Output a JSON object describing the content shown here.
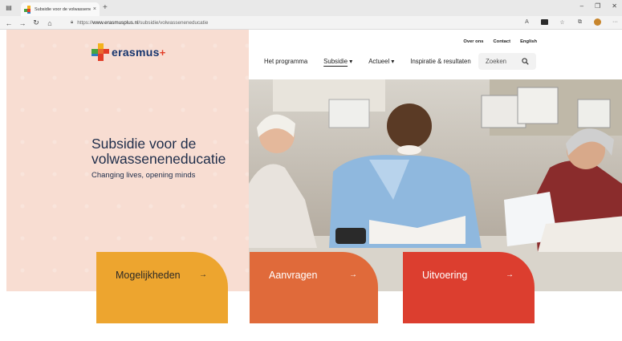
{
  "browser": {
    "tab_title": "Subsidie voor de volwasseneneducatie | Erasmus+",
    "tab_close": "×",
    "new_tab": "+",
    "url_prefix": "https://",
    "url_host": "www.erasmusplus.nl",
    "url_path": "/subsidie/volwasseneneducatie",
    "icons": [
      "tab-actions-icon",
      "back-icon",
      "forward-icon",
      "refresh-icon",
      "home-icon",
      "lock-icon",
      "read-aloud-icon",
      "extension-icon",
      "favorites-icon",
      "collections-icon",
      "profile-icon",
      "more-icon"
    ],
    "window_controls": {
      "minimize": "–",
      "maximize": "❐",
      "close": "✕"
    }
  },
  "brand": {
    "name": "erasmus",
    "plus": "+",
    "colors": {
      "navy": "#16356e",
      "red": "#e23d28",
      "yellow": "#f4b31c",
      "green": "#48a43f",
      "blue": "#2c7ec1",
      "orange": "#e86b30"
    }
  },
  "header": {
    "top_links": [
      "Over ons",
      "Contact",
      "English"
    ],
    "nav": [
      {
        "label": "Het programma",
        "dropdown": false,
        "active": false
      },
      {
        "label": "Subsidie",
        "dropdown": true,
        "active": true
      },
      {
        "label": "Actueel",
        "dropdown": true,
        "active": false
      },
      {
        "label": "Inspiratie & resultaten",
        "dropdown": false,
        "active": false
      }
    ],
    "search_placeholder": "Zoeken",
    "dropdown_glyph": "▾"
  },
  "hero": {
    "title": "Subsidie voor de volwasseneneducatie",
    "subtitle": "Changing lives, opening minds",
    "background_color": "#f8ddd2"
  },
  "cards": [
    {
      "label": "Mogelijkheden",
      "arrow": "→",
      "color": "#eda52f"
    },
    {
      "label": "Aanvragen",
      "arrow": "→",
      "color": "#e06a3a"
    },
    {
      "label": "Uitvoering",
      "arrow": "→",
      "color": "#dc3e2f"
    }
  ]
}
